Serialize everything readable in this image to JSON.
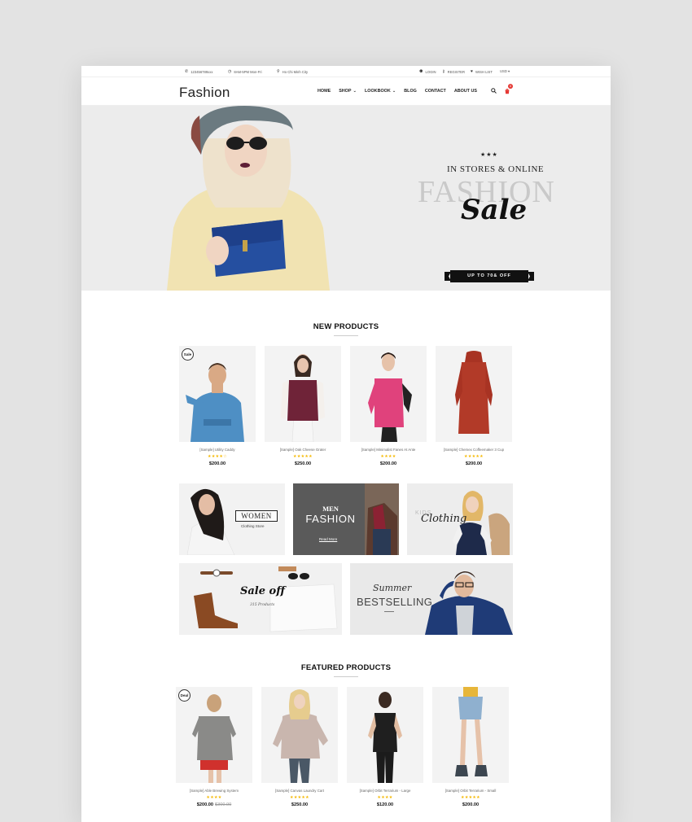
{
  "topbar": {
    "phone": "123456789xxx",
    "hours": "8AM-5PM Mon-Fri",
    "location": "Ho Chi Minh City",
    "login": "LOGIN",
    "register": "REGISTER",
    "wishlist": "WISH LIST",
    "currency": "USD ▾"
  },
  "header": {
    "logo": "Fashion",
    "nav": [
      "HOME",
      "SHOP",
      "LOOKBOOK",
      "BLOG",
      "CONTACT",
      "ABOUT US"
    ],
    "cart_count": "0"
  },
  "hero": {
    "stars": "★★★",
    "line1": "IN STORES & ONLINE",
    "fashion": "FASHION",
    "sale": "Sale",
    "ribbon": "UP TO 70& OFF"
  },
  "new_products": {
    "title": "NEW PRODUCTS",
    "items": [
      {
        "name": "[Sample] Utility Caddy",
        "stars": "★★★★☆",
        "price": "$200.00",
        "badge": "Sale"
      },
      {
        "name": "[Sample] Oak Cheese Grater",
        "stars": "★★★★★",
        "price": "$250.00"
      },
      {
        "name": "[Sample] Minimalist Fanes At Ante",
        "stars": "★★★★",
        "price": "$200.00"
      },
      {
        "name": "[Sample] Chemex Coffeemaker 3 Cup",
        "stars": "★★★★★",
        "price": "$200.00"
      }
    ]
  },
  "banners": {
    "women": {
      "title": "WOMEN",
      "sub": "Clothing Store"
    },
    "men": {
      "title": "MEN",
      "sub": "FASHION",
      "link": "Read More"
    },
    "kids": {
      "small": "KIDS",
      "title": "Clothing"
    },
    "sale": {
      "title": "Sale off",
      "sub": "315 Products"
    },
    "summer": {
      "title": "Summer",
      "sub": "BESTSELLING"
    }
  },
  "featured_products": {
    "title": "FEATURED PRODUCTS",
    "items": [
      {
        "name": "[Sample] Able Brewing System",
        "stars": "★★★★",
        "price": "$200.00",
        "old_price": "$300.00",
        "badge": "Deal"
      },
      {
        "name": "[Sample] Canvas Laundry Cart",
        "stars": "★★★★★",
        "price": "$250.00"
      },
      {
        "name": "[Sample] Orbit Terrarium - Large",
        "stars": "★★★★",
        "price": "$120.00"
      },
      {
        "name": "[Sample] Orbit Terrarium - Small",
        "stars": "★★★★★",
        "price": "$200.00"
      }
    ]
  },
  "colors": {
    "accent": "#e53935",
    "star": "#f5b800",
    "hero_bg": "#ececec"
  }
}
